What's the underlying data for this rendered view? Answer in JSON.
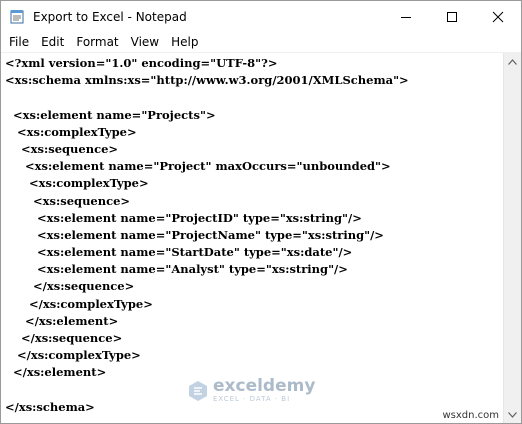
{
  "window": {
    "title": "Export to Excel - Notepad",
    "icon": "notepad-icon",
    "controls": [
      "minimize-icon",
      "maximize-icon",
      "close-icon"
    ]
  },
  "menu": {
    "file": "File",
    "edit": "Edit",
    "format": "Format",
    "view": "View",
    "help": "Help"
  },
  "editor": {
    "lines": [
      "<?xml version=\"1.0\" encoding=\"UTF-8\"?>",
      "<xs:schema xmlns:xs=\"http://www.w3.org/2001/XMLSchema\">",
      "",
      "  <xs:element name=\"Projects\">",
      "   <xs:complexType>",
      "    <xs:sequence>",
      "     <xs:element name=\"Project\" maxOccurs=\"unbounded\">",
      "      <xs:complexType>",
      "       <xs:sequence>",
      "        <xs:element name=\"ProjectID\" type=\"xs:string\"/>",
      "        <xs:element name=\"ProjectName\" type=\"xs:string\"/>",
      "        <xs:element name=\"StartDate\" type=\"xs:date\"/>",
      "        <xs:element name=\"Analyst\" type=\"xs:string\"/>",
      "       </xs:sequence>",
      "      </xs:complexType>",
      "     </xs:element>",
      "    </xs:sequence>",
      "   </xs:complexType>",
      "  </xs:element>",
      "",
      "</xs:schema>"
    ]
  },
  "watermark": {
    "name": "exceldemy",
    "tagline": "EXCEL · DATA · BI",
    "icon": "exceldemy-logo-icon"
  },
  "corner_label": "wsxdn.com"
}
